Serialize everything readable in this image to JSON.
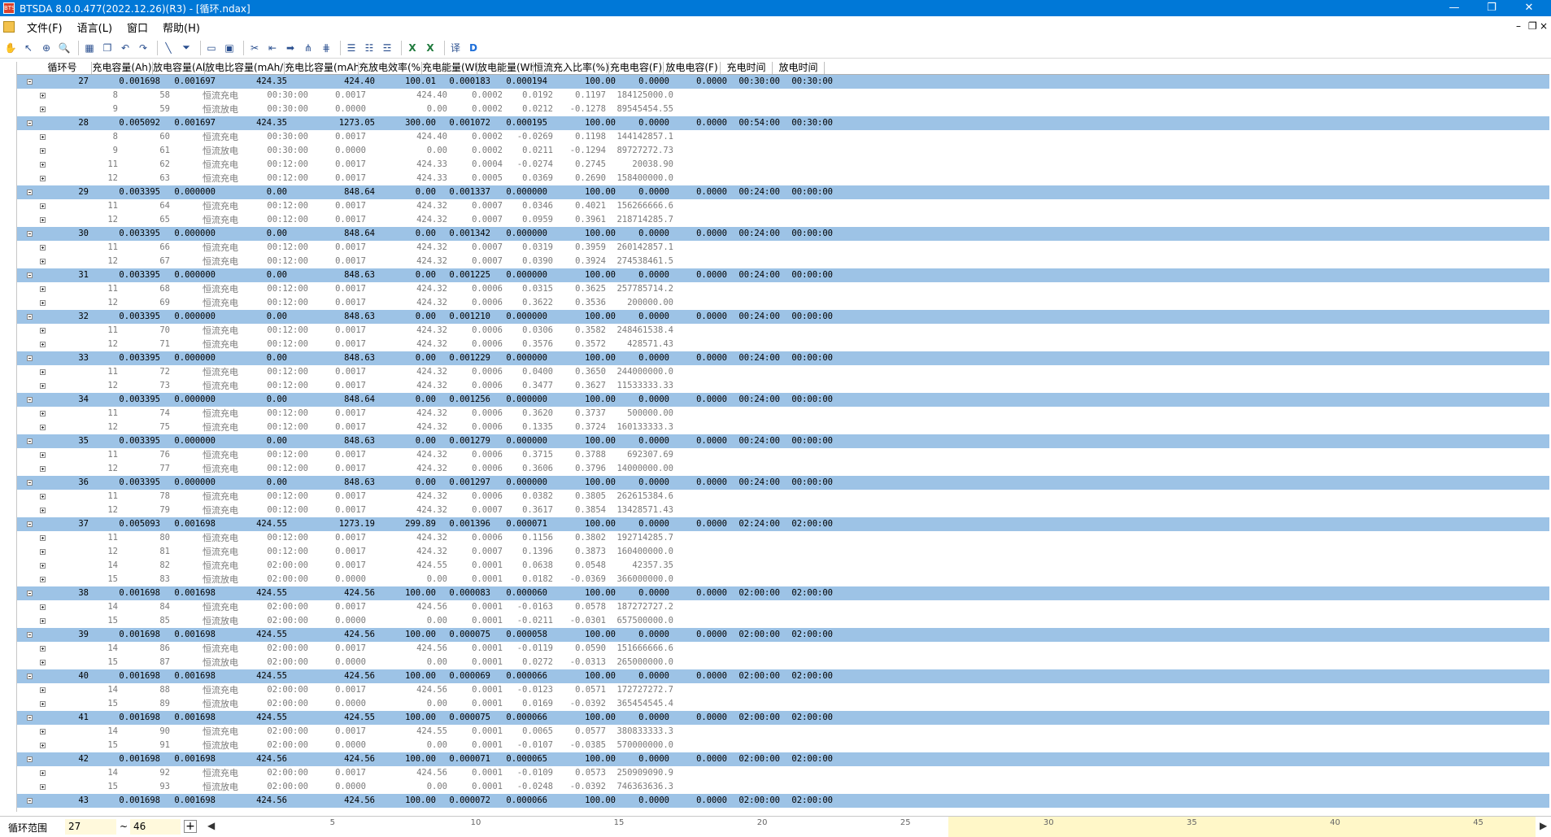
{
  "window": {
    "title": "BTSDA 8.0.0.477(2022.12.26)(R3) - [循环.ndax]",
    "app_icon_text": "BTS"
  },
  "menu": [
    "文件(F)",
    "语言(L)",
    "窗口",
    "帮助(H)"
  ],
  "toolbar": {
    "icons": [
      "hand-icon",
      "pointer-icon",
      "zoom-region-icon",
      "zoom-icon",
      "sep",
      "chart-icon",
      "copy-chart-icon",
      "undo-icon",
      "redo-icon",
      "sep",
      "line-tool-icon",
      "filter-icon",
      "sep",
      "open-folder-icon",
      "save-icon",
      "sep",
      "scissors-icon",
      "back-icon",
      "forward-icon",
      "split-icon",
      "merge-icon",
      "sep",
      "table-icon",
      "table-alt-icon",
      "table-filter-icon",
      "sep",
      "excel-icon",
      "excel-export-icon",
      "sep",
      "translate-icon",
      "d-icon"
    ]
  },
  "columns": [
    "循环号",
    "充电容量(Ah)",
    "放电容量(Ah)",
    "放电比容量(mAh/g)",
    "充电比容量(mAh/g)",
    "充放电效率(%)",
    "充电能量(Wh)",
    "放电能量(Wh)",
    "恒流充入比率(%)",
    "充电电容(F)",
    "放电电容(F)",
    "充电时间",
    "放电时间"
  ],
  "cycles": [
    {
      "c": [
        "27",
        "0.001698",
        "0.001697",
        "424.35",
        "424.40",
        "100.01",
        "0.000183",
        "0.000194",
        "100.00",
        "0.0000",
        "0.0000",
        "00:30:00",
        "00:30:00"
      ],
      "steps": [
        [
          "8",
          "58",
          "恒流充电",
          "00:30:00",
          "0.0017",
          "424.40",
          "0.0002",
          "0.0192",
          "0.1197",
          "184125000.0"
        ],
        [
          "9",
          "59",
          "恒流放电",
          "00:30:00",
          "0.0000",
          "0.00",
          "0.0002",
          "0.0212",
          "-0.1278",
          "89545454.55"
        ]
      ]
    },
    {
      "c": [
        "28",
        "0.005092",
        "0.001697",
        "424.35",
        "1273.05",
        "300.00",
        "0.001072",
        "0.000195",
        "100.00",
        "0.0000",
        "0.0000",
        "00:54:00",
        "00:30:00"
      ],
      "steps": [
        [
          "8",
          "60",
          "恒流充电",
          "00:30:00",
          "0.0017",
          "424.40",
          "0.0002",
          "-0.0269",
          "0.1198",
          "144142857.1"
        ],
        [
          "9",
          "61",
          "恒流放电",
          "00:30:00",
          "0.0000",
          "0.00",
          "0.0002",
          "0.0211",
          "-0.1294",
          "89727272.73"
        ],
        [
          "11",
          "62",
          "恒流充电",
          "00:12:00",
          "0.0017",
          "424.33",
          "0.0004",
          "-0.0274",
          "0.2745",
          "20038.90"
        ],
        [
          "12",
          "63",
          "恒流充电",
          "00:12:00",
          "0.0017",
          "424.33",
          "0.0005",
          "0.0369",
          "0.2690",
          "158400000.0"
        ]
      ]
    },
    {
      "c": [
        "29",
        "0.003395",
        "0.000000",
        "0.00",
        "848.64",
        "0.00",
        "0.001337",
        "0.000000",
        "100.00",
        "0.0000",
        "0.0000",
        "00:24:00",
        "00:00:00"
      ],
      "steps": [
        [
          "11",
          "64",
          "恒流充电",
          "00:12:00",
          "0.0017",
          "424.32",
          "0.0007",
          "0.0346",
          "0.4021",
          "156266666.6"
        ],
        [
          "12",
          "65",
          "恒流充电",
          "00:12:00",
          "0.0017",
          "424.32",
          "0.0007",
          "0.0959",
          "0.3961",
          "218714285.7"
        ]
      ]
    },
    {
      "c": [
        "30",
        "0.003395",
        "0.000000",
        "0.00",
        "848.64",
        "0.00",
        "0.001342",
        "0.000000",
        "100.00",
        "0.0000",
        "0.0000",
        "00:24:00",
        "00:00:00"
      ],
      "steps": [
        [
          "11",
          "66",
          "恒流充电",
          "00:12:00",
          "0.0017",
          "424.32",
          "0.0007",
          "0.0319",
          "0.3959",
          "260142857.1"
        ],
        [
          "12",
          "67",
          "恒流充电",
          "00:12:00",
          "0.0017",
          "424.32",
          "0.0007",
          "0.0390",
          "0.3924",
          "274538461.5"
        ]
      ]
    },
    {
      "c": [
        "31",
        "0.003395",
        "0.000000",
        "0.00",
        "848.63",
        "0.00",
        "0.001225",
        "0.000000",
        "100.00",
        "0.0000",
        "0.0000",
        "00:24:00",
        "00:00:00"
      ],
      "steps": [
        [
          "11",
          "68",
          "恒流充电",
          "00:12:00",
          "0.0017",
          "424.32",
          "0.0006",
          "0.0315",
          "0.3625",
          "257785714.2"
        ],
        [
          "12",
          "69",
          "恒流充电",
          "00:12:00",
          "0.0017",
          "424.32",
          "0.0006",
          "0.3622",
          "0.3536",
          "200000.00"
        ]
      ]
    },
    {
      "c": [
        "32",
        "0.003395",
        "0.000000",
        "0.00",
        "848.63",
        "0.00",
        "0.001210",
        "0.000000",
        "100.00",
        "0.0000",
        "0.0000",
        "00:24:00",
        "00:00:00"
      ],
      "steps": [
        [
          "11",
          "70",
          "恒流充电",
          "00:12:00",
          "0.0017",
          "424.32",
          "0.0006",
          "0.0306",
          "0.3582",
          "248461538.4"
        ],
        [
          "12",
          "71",
          "恒流充电",
          "00:12:00",
          "0.0017",
          "424.32",
          "0.0006",
          "0.3576",
          "0.3572",
          "428571.43"
        ]
      ]
    },
    {
      "c": [
        "33",
        "0.003395",
        "0.000000",
        "0.00",
        "848.63",
        "0.00",
        "0.001229",
        "0.000000",
        "100.00",
        "0.0000",
        "0.0000",
        "00:24:00",
        "00:00:00"
      ],
      "steps": [
        [
          "11",
          "72",
          "恒流充电",
          "00:12:00",
          "0.0017",
          "424.32",
          "0.0006",
          "0.0400",
          "0.3650",
          "244000000.0"
        ],
        [
          "12",
          "73",
          "恒流充电",
          "00:12:00",
          "0.0017",
          "424.32",
          "0.0006",
          "0.3477",
          "0.3627",
          "11533333.33"
        ]
      ]
    },
    {
      "c": [
        "34",
        "0.003395",
        "0.000000",
        "0.00",
        "848.64",
        "0.00",
        "0.001256",
        "0.000000",
        "100.00",
        "0.0000",
        "0.0000",
        "00:24:00",
        "00:00:00"
      ],
      "steps": [
        [
          "11",
          "74",
          "恒流充电",
          "00:12:00",
          "0.0017",
          "424.32",
          "0.0006",
          "0.3620",
          "0.3737",
          "500000.00"
        ],
        [
          "12",
          "75",
          "恒流充电",
          "00:12:00",
          "0.0017",
          "424.32",
          "0.0006",
          "0.1335",
          "0.3724",
          "160133333.3"
        ]
      ]
    },
    {
      "c": [
        "35",
        "0.003395",
        "0.000000",
        "0.00",
        "848.63",
        "0.00",
        "0.001279",
        "0.000000",
        "100.00",
        "0.0000",
        "0.0000",
        "00:24:00",
        "00:00:00"
      ],
      "steps": [
        [
          "11",
          "76",
          "恒流充电",
          "00:12:00",
          "0.0017",
          "424.32",
          "0.0006",
          "0.3715",
          "0.3788",
          "692307.69"
        ],
        [
          "12",
          "77",
          "恒流充电",
          "00:12:00",
          "0.0017",
          "424.32",
          "0.0006",
          "0.3606",
          "0.3796",
          "14000000.00"
        ]
      ]
    },
    {
      "c": [
        "36",
        "0.003395",
        "0.000000",
        "0.00",
        "848.63",
        "0.00",
        "0.001297",
        "0.000000",
        "100.00",
        "0.0000",
        "0.0000",
        "00:24:00",
        "00:00:00"
      ],
      "steps": [
        [
          "11",
          "78",
          "恒流充电",
          "00:12:00",
          "0.0017",
          "424.32",
          "0.0006",
          "0.0382",
          "0.3805",
          "262615384.6"
        ],
        [
          "12",
          "79",
          "恒流充电",
          "00:12:00",
          "0.0017",
          "424.32",
          "0.0007",
          "0.3617",
          "0.3854",
          "13428571.43"
        ]
      ]
    },
    {
      "c": [
        "37",
        "0.005093",
        "0.001698",
        "424.55",
        "1273.19",
        "299.89",
        "0.001396",
        "0.000071",
        "100.00",
        "0.0000",
        "0.0000",
        "02:24:00",
        "02:00:00"
      ],
      "steps": [
        [
          "11",
          "80",
          "恒流充电",
          "00:12:00",
          "0.0017",
          "424.32",
          "0.0006",
          "0.1156",
          "0.3802",
          "192714285.7"
        ],
        [
          "12",
          "81",
          "恒流充电",
          "00:12:00",
          "0.0017",
          "424.32",
          "0.0007",
          "0.1396",
          "0.3873",
          "160400000.0"
        ],
        [
          "14",
          "82",
          "恒流充电",
          "02:00:00",
          "0.0017",
          "424.55",
          "0.0001",
          "0.0638",
          "0.0548",
          "42357.35"
        ],
        [
          "15",
          "83",
          "恒流放电",
          "02:00:00",
          "0.0000",
          "0.00",
          "0.0001",
          "0.0182",
          "-0.0369",
          "366000000.0"
        ]
      ]
    },
    {
      "c": [
        "38",
        "0.001698",
        "0.001698",
        "424.55",
        "424.56",
        "100.00",
        "0.000083",
        "0.000060",
        "100.00",
        "0.0000",
        "0.0000",
        "02:00:00",
        "02:00:00"
      ],
      "steps": [
        [
          "14",
          "84",
          "恒流充电",
          "02:00:00",
          "0.0017",
          "424.56",
          "0.0001",
          "-0.0163",
          "0.0578",
          "187272727.2"
        ],
        [
          "15",
          "85",
          "恒流放电",
          "02:00:00",
          "0.0000",
          "0.00",
          "0.0001",
          "-0.0211",
          "-0.0301",
          "657500000.0"
        ]
      ]
    },
    {
      "c": [
        "39",
        "0.001698",
        "0.001698",
        "424.55",
        "424.56",
        "100.00",
        "0.000075",
        "0.000058",
        "100.00",
        "0.0000",
        "0.0000",
        "02:00:00",
        "02:00:00"
      ],
      "steps": [
        [
          "14",
          "86",
          "恒流充电",
          "02:00:00",
          "0.0017",
          "424.56",
          "0.0001",
          "-0.0119",
          "0.0590",
          "151666666.6"
        ],
        [
          "15",
          "87",
          "恒流放电",
          "02:00:00",
          "0.0000",
          "0.00",
          "0.0001",
          "0.0272",
          "-0.0313",
          "265000000.0"
        ]
      ]
    },
    {
      "c": [
        "40",
        "0.001698",
        "0.001698",
        "424.55",
        "424.56",
        "100.00",
        "0.000069",
        "0.000066",
        "100.00",
        "0.0000",
        "0.0000",
        "02:00:00",
        "02:00:00"
      ],
      "steps": [
        [
          "14",
          "88",
          "恒流充电",
          "02:00:00",
          "0.0017",
          "424.56",
          "0.0001",
          "-0.0123",
          "0.0571",
          "172727272.7"
        ],
        [
          "15",
          "89",
          "恒流放电",
          "02:00:00",
          "0.0000",
          "0.00",
          "0.0001",
          "0.0169",
          "-0.0392",
          "365454545.4"
        ]
      ]
    },
    {
      "c": [
        "41",
        "0.001698",
        "0.001698",
        "424.55",
        "424.55",
        "100.00",
        "0.000075",
        "0.000066",
        "100.00",
        "0.0000",
        "0.0000",
        "02:00:00",
        "02:00:00"
      ],
      "steps": [
        [
          "14",
          "90",
          "恒流充电",
          "02:00:00",
          "0.0017",
          "424.55",
          "0.0001",
          "0.0065",
          "0.0577",
          "380833333.3"
        ],
        [
          "15",
          "91",
          "恒流放电",
          "02:00:00",
          "0.0000",
          "0.00",
          "0.0001",
          "-0.0107",
          "-0.0385",
          "570000000.0"
        ]
      ]
    },
    {
      "c": [
        "42",
        "0.001698",
        "0.001698",
        "424.56",
        "424.56",
        "100.00",
        "0.000071",
        "0.000065",
        "100.00",
        "0.0000",
        "0.0000",
        "02:00:00",
        "02:00:00"
      ],
      "steps": [
        [
          "14",
          "92",
          "恒流充电",
          "02:00:00",
          "0.0017",
          "424.56",
          "0.0001",
          "-0.0109",
          "0.0573",
          "250909090.9"
        ],
        [
          "15",
          "93",
          "恒流放电",
          "02:00:00",
          "0.0000",
          "0.00",
          "0.0001",
          "-0.0248",
          "-0.0392",
          "746363636.3"
        ]
      ]
    },
    {
      "c": [
        "43",
        "0.001698",
        "0.001698",
        "424.56",
        "424.56",
        "100.00",
        "0.000072",
        "0.000066",
        "100.00",
        "0.0000",
        "0.0000",
        "02:00:00",
        "02:00:00"
      ],
      "steps": []
    }
  ],
  "bottom": {
    "label": "循环范围",
    "from": "27",
    "tilde": "~",
    "to": "46",
    "plus": "+",
    "left_arrow": "◀",
    "right_arrow": "▶",
    "scale_ticks": [
      "5",
      "10",
      "15",
      "20",
      "25",
      "30",
      "35",
      "40",
      "45"
    ],
    "scale_min": 1,
    "scale_max": 46,
    "highlight_from": 27,
    "highlight_to": 46
  }
}
